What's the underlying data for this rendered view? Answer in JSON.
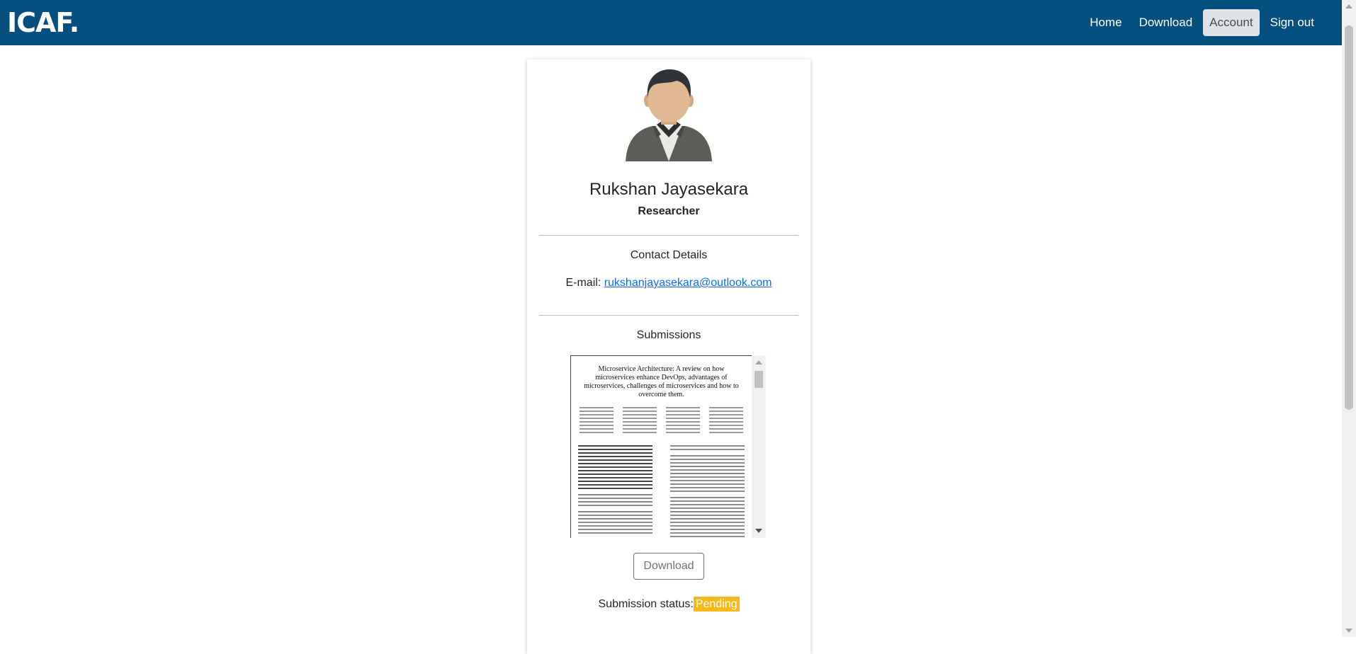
{
  "navbar": {
    "brand": "ICAF.",
    "links": [
      {
        "label": "Home"
      },
      {
        "label": "Download"
      },
      {
        "label": "Account",
        "active": true
      },
      {
        "label": "Sign out"
      }
    ],
    "color": "#03507e"
  },
  "profile": {
    "avatar": "user-avatar-icon",
    "name": "Rukshan Jayasekara",
    "role": "Researcher"
  },
  "contact": {
    "heading": "Contact Details",
    "email_label": "E-mail:",
    "email": "rukshanjayasekara@outlook.com"
  },
  "submissions": {
    "heading": "Submissions",
    "document_title": "Microservice Architecture: A review on how microservices enhance DevOps, advantages of microservices, challenges of microservices and how to overcome them.",
    "download_label": "Download",
    "status_label": "Submission status:",
    "status_value": "Pending",
    "status_color": "#f6b91a"
  }
}
